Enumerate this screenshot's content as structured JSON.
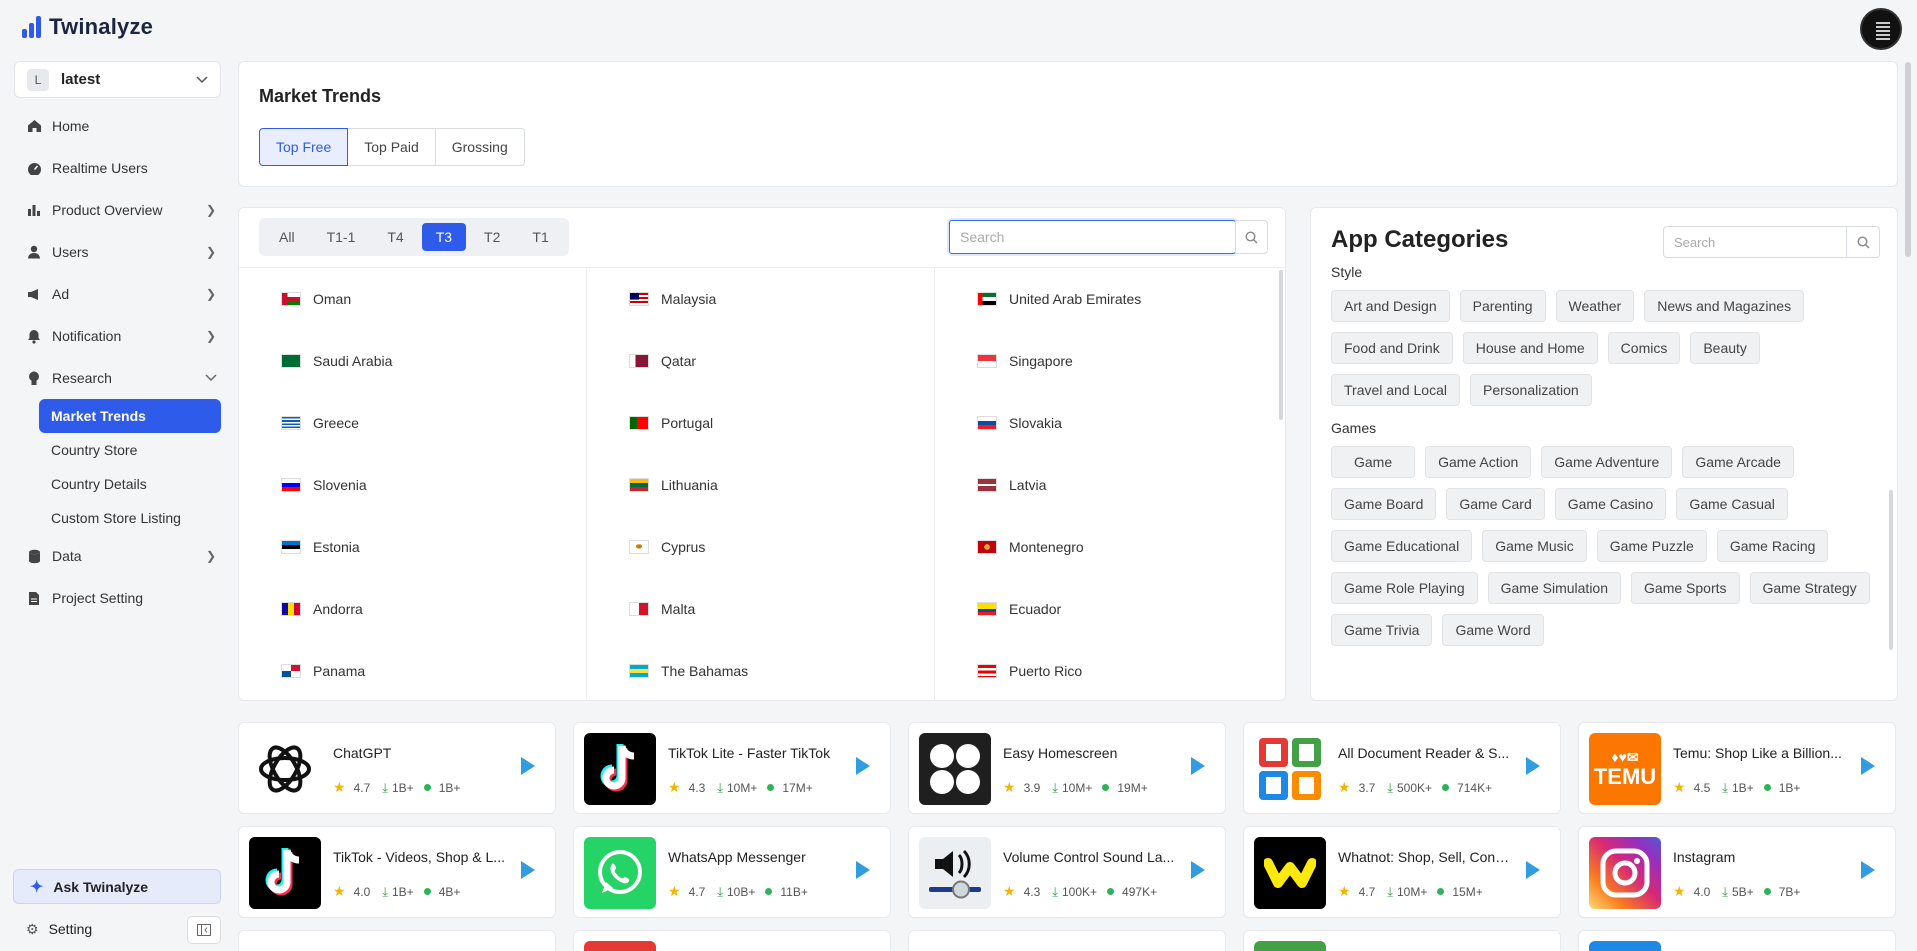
{
  "brand": {
    "name": "Twinalyze"
  },
  "project_select": {
    "badge": "L",
    "value": "latest"
  },
  "nav": {
    "items": [
      {
        "label": "Home",
        "icon": "home-icon"
      },
      {
        "label": "Realtime Users",
        "icon": "gauge-icon"
      },
      {
        "label": "Product Overview",
        "icon": "bar-chart-icon",
        "expandable": true
      },
      {
        "label": "Users",
        "icon": "user-icon",
        "expandable": true
      },
      {
        "label": "Ad",
        "icon": "ad-icon",
        "expandable": true
      },
      {
        "label": "Notification",
        "icon": "bell-icon",
        "expandable": true
      },
      {
        "label": "Research",
        "icon": "bulb-icon",
        "expanded": true
      }
    ],
    "research_sub": [
      "Market Trends",
      "Country Store",
      "Country Details",
      "Custom Store Listing"
    ],
    "after": [
      {
        "label": "Data",
        "icon": "database-icon",
        "expandable": true
      },
      {
        "label": "Project Setting",
        "icon": "file-icon"
      }
    ]
  },
  "ask": {
    "label": "Ask Twinalyze"
  },
  "setting": {
    "label": "Setting"
  },
  "market_trends": {
    "title": "Market Trends",
    "segments": [
      "Top Free",
      "Top Paid",
      "Grossing"
    ],
    "active": "Top Free"
  },
  "countries": {
    "tiers": [
      "All",
      "T1-1",
      "T4",
      "T3",
      "T2",
      "T1"
    ],
    "active_tier": "T3",
    "search_placeholder": "Search",
    "rows": [
      [
        "Oman",
        "Malaysia",
        "United Arab Emirates"
      ],
      [
        "Saudi Arabia",
        "Qatar",
        "Singapore"
      ],
      [
        "Greece",
        "Portugal",
        "Slovakia"
      ],
      [
        "Slovenia",
        "Lithuania",
        "Latvia"
      ],
      [
        "Estonia",
        "Cyprus",
        "Montenegro"
      ],
      [
        "Andorra",
        "Malta",
        "Ecuador"
      ],
      [
        "Panama",
        "The Bahamas",
        "Puerto Rico"
      ]
    ]
  },
  "categories": {
    "title": "App Categories",
    "search_placeholder": "Search",
    "style_label": "Style",
    "style": [
      "Art and Design",
      "Parenting",
      "Weather",
      "News and Magazines",
      "Food and Drink",
      "House and Home",
      "Comics",
      "Beauty",
      "Travel and Local",
      "Personalization"
    ],
    "games_label": "Games",
    "games": [
      "Game",
      "Game Action",
      "Game Adventure",
      "Game Arcade",
      "Game Board",
      "Game Card",
      "Game Casino",
      "Game Casual",
      "Game Educational",
      "Game Music",
      "Game Puzzle",
      "Game Racing",
      "Game Role Playing",
      "Game Simulation",
      "Game Sports",
      "Game Strategy",
      "Game Trivia",
      "Game Word"
    ]
  },
  "apps": [
    {
      "name": "ChatGPT",
      "rating": "4.7",
      "downloads": "1B+",
      "total": "1B+",
      "icon": "chatgpt-icon"
    },
    {
      "name": "TikTok Lite - Faster TikTok",
      "rating": "4.3",
      "downloads": "10M+",
      "total": "17M+",
      "icon": "tiktok-icon"
    },
    {
      "name": "Easy Homescreen",
      "rating": "3.9",
      "downloads": "10M+",
      "total": "19M+",
      "icon": "homescreen-icon"
    },
    {
      "name": "All Document Reader & S...",
      "rating": "3.7",
      "downloads": "500K+",
      "total": "714K+",
      "icon": "document-reader-icon"
    },
    {
      "name": "Temu: Shop Like a Billion...",
      "rating": "4.5",
      "downloads": "1B+",
      "total": "1B+",
      "icon": "temu-icon"
    },
    {
      "name": "TikTok - Videos, Shop & L...",
      "rating": "4.0",
      "downloads": "1B+",
      "total": "4B+",
      "icon": "tiktok-icon"
    },
    {
      "name": "WhatsApp Messenger",
      "rating": "4.7",
      "downloads": "10B+",
      "total": "11B+",
      "icon": "whatsapp-icon"
    },
    {
      "name": "Volume Control Sound La...",
      "rating": "4.3",
      "downloads": "100K+",
      "total": "497K+",
      "icon": "volume-icon"
    },
    {
      "name": "Whatnot: Shop, Sell, Conn...",
      "rating": "4.7",
      "downloads": "10M+",
      "total": "15M+",
      "icon": "whatnot-icon"
    },
    {
      "name": "Instagram",
      "rating": "4.0",
      "downloads": "5B+",
      "total": "7B+",
      "icon": "instagram-icon"
    }
  ],
  "colors": {
    "accent": "#2f5bea",
    "active_bg": "#e8eefd"
  }
}
